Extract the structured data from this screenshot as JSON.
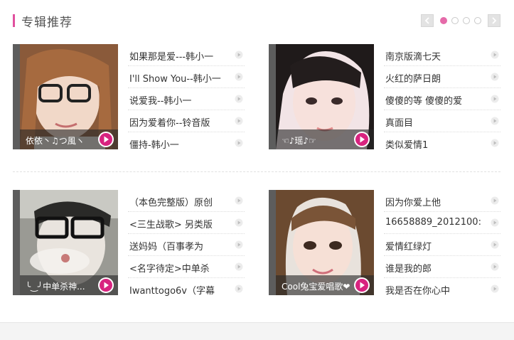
{
  "header": {
    "title": "专辑推荐"
  },
  "pager": {
    "dots": [
      true,
      false,
      false,
      false
    ]
  },
  "albums": [
    {
      "cover_caption": "依依丶♫つ風ヽ",
      "songs": [
        "如果那是爱---韩小一",
        "I'll Show You--韩小一",
        "说爱我--韩小一",
        "因为爱着你--铃音版",
        "僵持-韩小一"
      ]
    },
    {
      "cover_caption": "☜♪瑶♪☞",
      "songs": [
        "南京版滴七天",
        "火红的萨日朗",
        "傻傻的等 傻傻的爱",
        "真面目",
        "类似爱情1"
      ]
    },
    {
      "cover_caption": "╰‿╯中单杀神...",
      "songs": [
        "（本色完整版）原创",
        "<三生战歌> 另类版",
        "送妈妈（百事孝为",
        "<名字待定>中单杀",
        "Iwanttogo6v（字幕"
      ]
    },
    {
      "cover_caption": "Cool兔宝爱唱歌❤",
      "songs": [
        "因为你爱上他",
        "16658889_2012100:",
        "爱情红绿灯",
        "谁是我的郎",
        "我是否在你心中"
      ]
    }
  ],
  "colors": {
    "accent": "#e0509e",
    "play": "#d8237f"
  },
  "icons": {
    "prev": "chevron-left-icon",
    "next": "chevron-right-icon",
    "play": "play-icon"
  }
}
